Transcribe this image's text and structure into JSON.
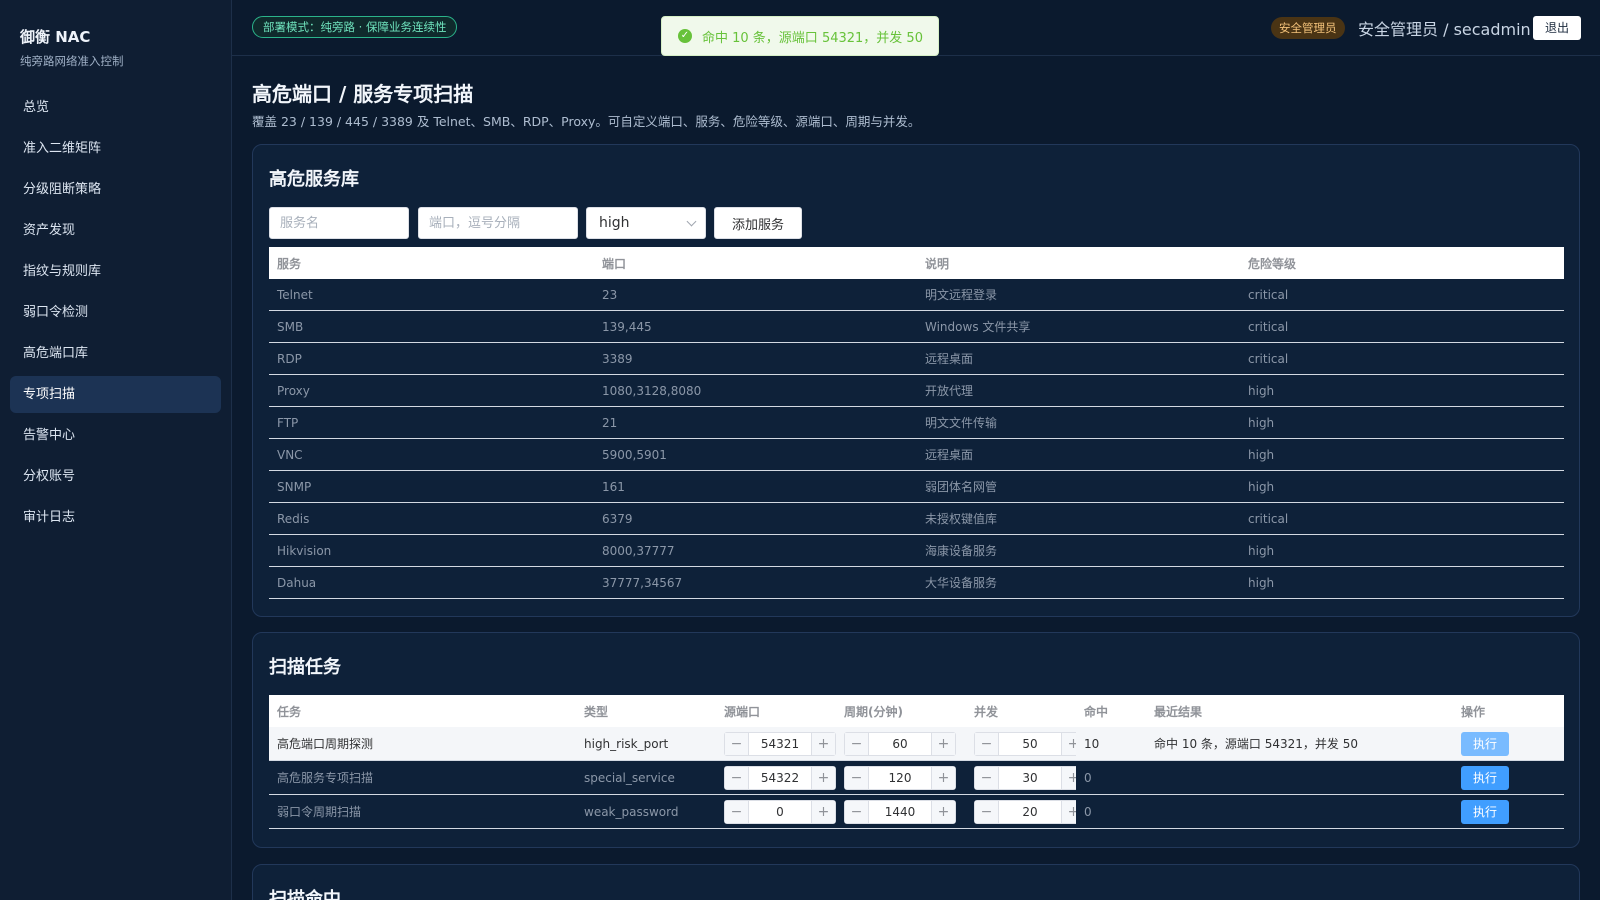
{
  "brand": {
    "title": "御衡 NAC",
    "subtitle": "纯旁路网络准入控制"
  },
  "nav": {
    "items": [
      "总览",
      "准入二维矩阵",
      "分级阻断策略",
      "资产发现",
      "指纹与规则库",
      "弱口令检测",
      "高危端口库",
      "专项扫描",
      "告警中心",
      "分权账号",
      "审计日志"
    ],
    "active": "专项扫描"
  },
  "topbar": {
    "mode_badge": "部署模式：纯旁路 · 保障业务连续性",
    "role_badge": "安全管理员",
    "user": "安全管理员 / secadmin",
    "logout": "退出"
  },
  "toast": {
    "icon": "check-icon",
    "message": "命中 10 条，源端口 54321，并发 50",
    "color": "#67c23a"
  },
  "page": {
    "title": "高危端口 / 服务专项扫描",
    "description": "覆盖 23 / 139 / 445 / 3389 及 Telnet、SMB、RDP、Proxy。可自定义端口、服务、危险等级、源端口、周期与并发。"
  },
  "service_lib": {
    "title": "高危服务库",
    "name_placeholder": "服务名",
    "ports_placeholder": "端口，逗号分隔",
    "level_value": "high",
    "add_button": "添加服务",
    "columns": [
      "服务",
      "端口",
      "说明",
      "危险等级"
    ],
    "rows": [
      [
        "Telnet",
        "23",
        "明文远程登录",
        "critical"
      ],
      [
        "SMB",
        "139,445",
        "Windows 文件共享",
        "critical"
      ],
      [
        "RDP",
        "3389",
        "远程桌面",
        "critical"
      ],
      [
        "Proxy",
        "1080,3128,8080",
        "开放代理",
        "high"
      ],
      [
        "FTP",
        "21",
        "明文文件传输",
        "high"
      ],
      [
        "VNC",
        "5900,5901",
        "远程桌面",
        "high"
      ],
      [
        "SNMP",
        "161",
        "弱团体名网管",
        "high"
      ],
      [
        "Redis",
        "6379",
        "未授权键值库",
        "critical"
      ],
      [
        "Hikvision",
        "8000,37777",
        "海康设备服务",
        "high"
      ],
      [
        "Dahua",
        "37777,34567",
        "大华设备服务",
        "high"
      ]
    ]
  },
  "tasks": {
    "title": "扫描任务",
    "columns": [
      "任务",
      "类型",
      "源端口",
      "周期(分钟)",
      "并发",
      "命中",
      "最近结果",
      "操作"
    ],
    "run_label": "执行",
    "rows": [
      {
        "name": "高危端口周期探测",
        "type": "high_risk_port",
        "src_port": "54321",
        "period": "60",
        "concurrency": "50",
        "hits": "10",
        "result": "命中 10 条，源端口 54321，并发 50"
      },
      {
        "name": "高危服务专项扫描",
        "type": "special_service",
        "src_port": "54322",
        "period": "120",
        "concurrency": "30",
        "hits": "0",
        "result": ""
      },
      {
        "name": "弱口令周期扫描",
        "type": "weak_password",
        "src_port": "0",
        "period": "1440",
        "concurrency": "20",
        "hits": "0",
        "result": ""
      }
    ]
  },
  "hits_section": {
    "title": "扫描命中"
  },
  "colors": {
    "accent": "#409eff",
    "success": "#67c23a",
    "warning_badge": "#f3c27a",
    "mode_badge": "#2bb38a"
  }
}
